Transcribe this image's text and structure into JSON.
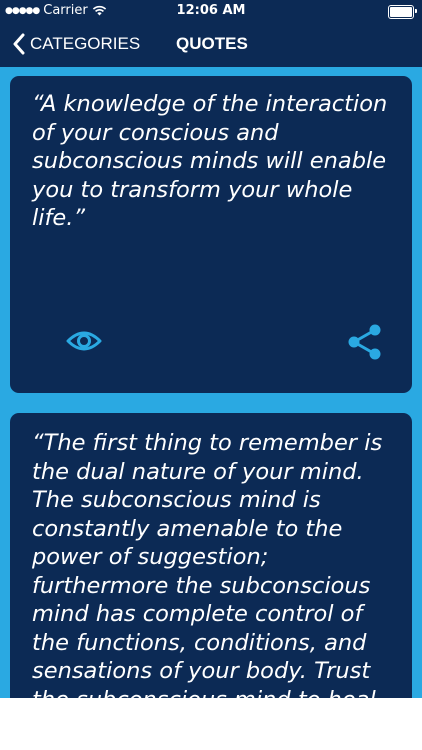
{
  "status_bar": {
    "carrier": "Carrier",
    "time": "12:06 AM"
  },
  "nav": {
    "back_label": "CATEGORIES",
    "title": "QUOTES"
  },
  "quotes": [
    {
      "text": "“A knowledge of the interaction of your conscious and subconscious minds will enable you to transform your whole life.”",
      "actions": [
        "eye-icon",
        "share-icon"
      ]
    },
    {
      "text": "“The first thing to remember is the dual nature of your mind. The subconscious mind is constantly amenable to the power of suggestion; furthermore the subconscious mind has complete control of the functions, conditions, and sensations of your body. Trust the subconscious mind to heal"
    }
  ],
  "colors": {
    "background": "#2aa9e2",
    "card": "#0c2a55",
    "accent": "#2aa9e2",
    "text": "#ffffff"
  }
}
